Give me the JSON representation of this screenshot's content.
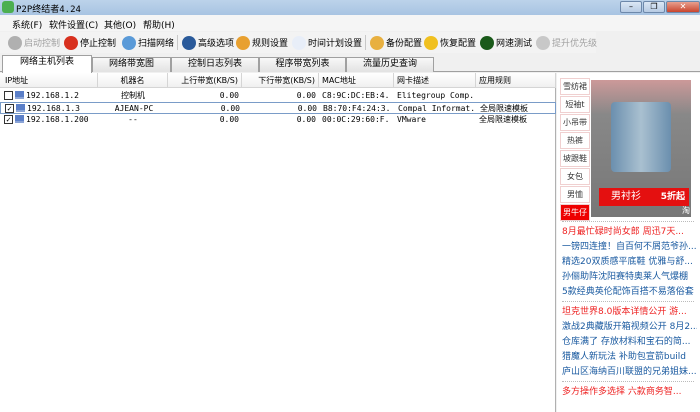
{
  "window": {
    "title": "P2P终结者4.24",
    "min": "–",
    "max": "❐",
    "close": "✕"
  },
  "menu": [
    "系统(F)",
    "软件设置(C)",
    "其他(O)",
    "帮助(H)"
  ],
  "toolbar": [
    {
      "label": "启动控制",
      "icon": "check-circle-icon",
      "disabled": true,
      "color": "#b0b0b0"
    },
    {
      "label": "停止控制",
      "icon": "stop-icon",
      "disabled": false,
      "color": "#d8301e"
    },
    {
      "label": "扫描网络",
      "icon": "magnifier-icon",
      "disabled": false,
      "color": "#5a9ad8"
    },
    {
      "label": "高级选项",
      "icon": "globe-icon",
      "disabled": false,
      "color": "#2a5a9a"
    },
    {
      "label": "规则设置",
      "icon": "folder-gear-icon",
      "disabled": false,
      "color": "#e8a030"
    },
    {
      "label": "时间计划设置",
      "icon": "clock-icon",
      "disabled": false,
      "color": "#e8eef8"
    },
    {
      "label": "备份配置",
      "icon": "backup-icon",
      "disabled": false,
      "color": "#e8b040"
    },
    {
      "label": "恢复配置",
      "icon": "restore-icon",
      "disabled": false,
      "color": "#f0c020"
    },
    {
      "label": "网速测试",
      "icon": "speed-chart-icon",
      "disabled": false,
      "color": "#1a5a1a"
    },
    {
      "label": "提升优先级",
      "icon": "shield-icon",
      "disabled": true,
      "color": "#c8c8c8"
    }
  ],
  "tabs": [
    "网络主机列表",
    "网络带宽图",
    "控制日志列表",
    "程序带宽列表",
    "流量历史查询"
  ],
  "table": {
    "columns": [
      "IP地址",
      "机器名",
      "上行带宽(KB/S)",
      "下行带宽(KB/S)",
      "MAC地址",
      "网卡描述",
      "应用规则"
    ],
    "rows": [
      {
        "checked": false,
        "ip": "192.168.1.2",
        "name": "控制机",
        "up": "0.00",
        "down": "0.00",
        "mac": "C8:9C:DC:EB:4...",
        "nic": "Elitegroup Comp...",
        "rule": ""
      },
      {
        "checked": true,
        "ip": "192.168.1.3",
        "name": "AJEAN-PC",
        "up": "0.00",
        "down": "0.00",
        "mac": "B8:70:F4:24:3...",
        "nic": "Compal Informat...",
        "rule": "全局限速模板"
      },
      {
        "checked": true,
        "ip": "192.168.1.200",
        "name": "--",
        "up": "0.00",
        "down": "0.00",
        "mac": "00:0C:29:60:F...",
        "nic": "VMware",
        "rule": "全局限速模板"
      }
    ]
  },
  "ad": {
    "categories": [
      "雪纺裙",
      "短袖t",
      "小吊带",
      "热裤",
      "坡跟鞋",
      "女包",
      "男恤",
      "男牛仔"
    ],
    "banner": "男衬衫",
    "banner_badge": "5折起",
    "corner": "淘",
    "news": [
      {
        "text": "8月最忙碌时尚女郎 周迅7天...",
        "hot": true
      },
      {
        "text": "一镑四连撞！自百何不屑范爷孙...",
        "hot": false
      },
      {
        "text": "精选20双质感平底鞋 优雅与舒...",
        "hot": false
      },
      {
        "text": "孙俪助阵沈阳赛特奥莱人气爆棚",
        "hot": false
      },
      {
        "text": "5款经典英伦配饰百搭不易落俗套",
        "hot": false
      },
      {
        "text": "坦克世界8.0版本详情公开 游...",
        "hot": true
      },
      {
        "text": "激战2典藏版开箱视频公开 8月2...",
        "hot": false
      },
      {
        "text": "仓库满了 存放材料和宝石的简...",
        "hot": false
      },
      {
        "text": "猎魔人新玩法 补助包宣箭build",
        "hot": false
      },
      {
        "text": "庐山区海纳百川联盟的兄弟姐妹...",
        "hot": false
      },
      {
        "text": "多方操作多选择 六款商务智...",
        "hot": true
      }
    ]
  }
}
